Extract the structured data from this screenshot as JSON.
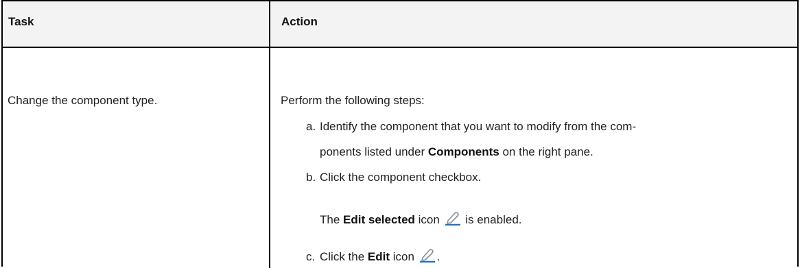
{
  "table": {
    "headers": {
      "task": "Task",
      "action": "Action"
    },
    "rows": [
      {
        "task": "Change the component type.",
        "action": {
          "intro": "Perform the following steps:",
          "steps": {
            "a": {
              "marker": "a.",
              "line1": "Identify the component that you want to modify from the com-",
              "line2_prefix": "ponents listed under ",
              "line2_bold": "Components",
              "line2_suffix": " on the right pane."
            },
            "b": {
              "marker": "b.",
              "text": "Click the component checkbox.",
              "note_prefix": "The ",
              "note_bold": "Edit selected",
              "note_mid": " icon ",
              "note_suffix": " is enabled."
            },
            "c": {
              "marker": "c.",
              "prefix": "Click the ",
              "bold": "Edit",
              "mid": " icon ",
              "suffix": "."
            }
          }
        }
      }
    ]
  },
  "icons": {
    "edit": "pencil-edit-icon",
    "accent_color": "#1d6fbf"
  }
}
